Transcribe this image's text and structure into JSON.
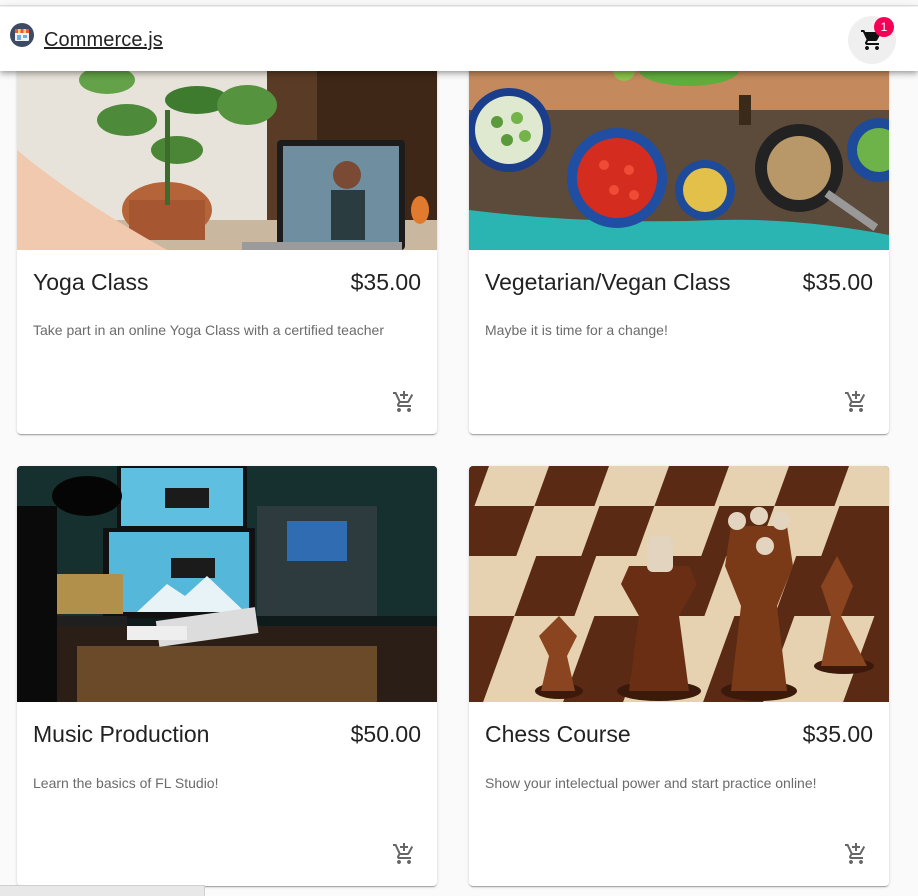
{
  "appbar": {
    "brand": "Commerce.js",
    "logo_icon": "storefront-logo-icon",
    "cart_icon": "shopping-cart-icon",
    "cart_count": "1",
    "badge_color": "#f50057"
  },
  "products": [
    {
      "name": "Yoga Class",
      "price": "$35.00",
      "description": "Take part in an online Yoga Class with a certified teacher",
      "image": "yoga-photo",
      "action_icon": "add-shopping-cart-icon"
    },
    {
      "name": "Vegetarian/Vegan Class",
      "price": "$35.00",
      "description": "Maybe it is time for a change!",
      "image": "vegetables-photo",
      "action_icon": "add-shopping-cart-icon"
    },
    {
      "name": "Music Production",
      "price": "$50.00",
      "description": "Learn the basics of FL Studio!",
      "image": "studio-desk-photo",
      "action_icon": "add-shopping-cart-icon"
    },
    {
      "name": "Chess Course",
      "price": "$35.00",
      "description": "Show your intelectual power and start practice online!",
      "image": "chess-photo",
      "action_icon": "add-shopping-cart-icon"
    }
  ]
}
